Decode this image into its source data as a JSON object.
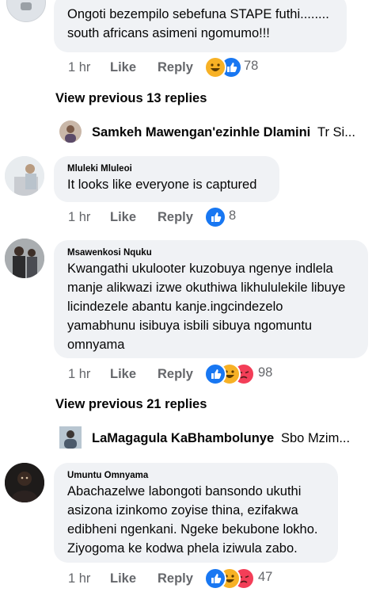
{
  "comments": [
    {
      "author": "",
      "lines": [
        "Ongoti bezempilo sebefuna STAPE futhi........",
        "south africans asimeni ngomumo!!!"
      ],
      "time": "1 hr",
      "like_label": "Like",
      "reply_label": "Reply",
      "reactions": [
        "haha-icon",
        "like-icon"
      ],
      "reaction_count": "78"
    },
    {
      "author": "Mluleki Mluleoi",
      "lines": [
        "It looks like everyone is captured"
      ],
      "time": "1 hr",
      "like_label": "Like",
      "reply_label": "Reply",
      "reactions": [
        "like-icon"
      ],
      "reaction_count": "8"
    },
    {
      "author": "Msawenkosi Nquku",
      "lines": [
        "Kwangathi ukulooter kuzobuya ngenye indlela",
        "manje alikwazi izwe okuthiwa likhululekile libuye",
        "licindezele abantu kanje.ingcindezelo",
        "yamabhunu isibuya isbili sibuya ngomuntu",
        "omnyama"
      ],
      "time": "1 hr",
      "like_label": "Like",
      "reply_label": "Reply",
      "reactions": [
        "like-icon",
        "haha-icon",
        "angry-icon"
      ],
      "reaction_count": "98"
    },
    {
      "author": "Umuntu Omnyama",
      "lines": [
        "Abachazelwe labongoti bansondo ukuthi",
        "asizona izinkomo zoyise thina, ezifakwa",
        "edibheni ngenkani. Ngeke bekubone lokho.",
        "Ziyogoma ke kodwa phela iziwula zabo."
      ],
      "time": "1 hr",
      "like_label": "Like",
      "reply_label": "Reply",
      "reactions": [
        "like-icon",
        "haha-icon",
        "angry-icon"
      ],
      "reaction_count": "47"
    }
  ],
  "view_previous": [
    "View previous 13 replies",
    "View previous 21 replies"
  ],
  "reply_previews": [
    {
      "name": "Samkeh Mawengan'ezinhle Dlamini",
      "snippet": "Tr Si..."
    },
    {
      "name": "LaMagagula KaBhambolunye",
      "snippet": "Sbo Mzim..."
    }
  ],
  "colors": {
    "like": "#1877f2",
    "haha": "#f7b125",
    "angry": "#f33e58",
    "bubble": "#f0f2f5",
    "meta": "#65676b"
  }
}
